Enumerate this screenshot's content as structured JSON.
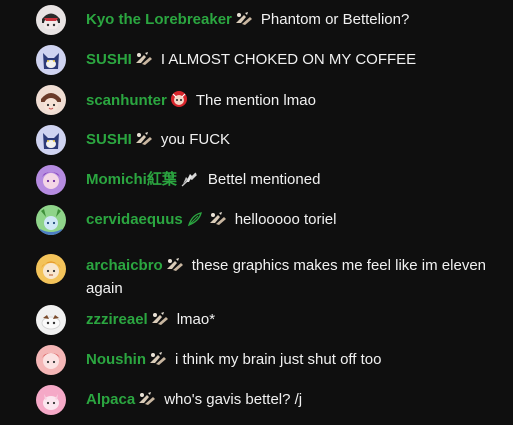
{
  "chat": {
    "messages": [
      {
        "author": "Kyo the Lorebreaker",
        "text": "Phantom or Bettelion?",
        "badge": "member-badge",
        "avatar_color": "#e8e3e3"
      },
      {
        "author": "SUSHI",
        "text": "I ALMOST CHOKED ON MY COFFEE",
        "badge": "member-badge",
        "avatar_color": "#cfd3f0"
      },
      {
        "author": "scanhunter",
        "text": "The mention lmao",
        "badge": "face-badge",
        "avatar_color": "#f0ddd3"
      },
      {
        "author": "SUSHI",
        "text": "you FUCK",
        "badge": "member-badge",
        "avatar_color": "#cfd3f0"
      },
      {
        "author": "Momichi紅葉",
        "text": "Bettel mentioned",
        "badge": "feather-badge",
        "avatar_color": "#b58be0"
      },
      {
        "author": "cervidaequus",
        "text": "hellooooo toriel",
        "badge": "member-badge",
        "avatar_color": "#8fd48a"
      },
      {
        "author": "archaicbro",
        "text": "these graphics makes me feel like im eleven again",
        "badge": "member-badge",
        "avatar_color": "#f3c35a"
      },
      {
        "author": "zzzireael",
        "text": "lmao*",
        "badge": "member-badge",
        "avatar_color": "#f1f1f1"
      },
      {
        "author": "Noushin",
        "text": "i think my brain just shut off too",
        "badge": "member-badge",
        "avatar_color": "#f4b6b6"
      },
      {
        "author": "Alpaca",
        "text": "who's gavis bettel? /j",
        "badge": "member-badge",
        "avatar_color": "#f5a9c7"
      }
    ]
  },
  "colors": {
    "background": "#0f0f0f",
    "member_name": "#2ba640",
    "message_text": "#f1f1f1"
  }
}
